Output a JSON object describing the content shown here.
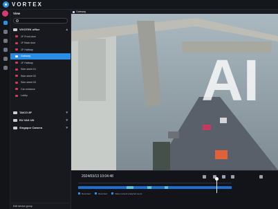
{
  "app": {
    "brand": "VORTEX"
  },
  "sidebar": {
    "title": "View",
    "search_placeholder": "",
    "groups": [
      {
        "label": "VIVOTEK office",
        "cameras": [
          "1F Front door",
          "1F Back door",
          "1F Hallway",
          "Gateway",
          "1F Hallway",
          "Side street 01",
          "Side street 02",
          "Side street 03",
          "Car entrance",
          "Lobby"
        ]
      },
      {
        "label": "TAICO 8F"
      },
      {
        "label": "EU VAS UK"
      },
      {
        "label": "Singapor Camera"
      }
    ],
    "footer": "Edit device group"
  },
  "feed": {
    "title": "Gateway",
    "overlay_text": "AI"
  },
  "controls": {
    "timestamp": "2024/03/13 10:04:48",
    "legend": [
      "Recorded",
      "Recorded",
      "Video content analyzed event"
    ]
  }
}
